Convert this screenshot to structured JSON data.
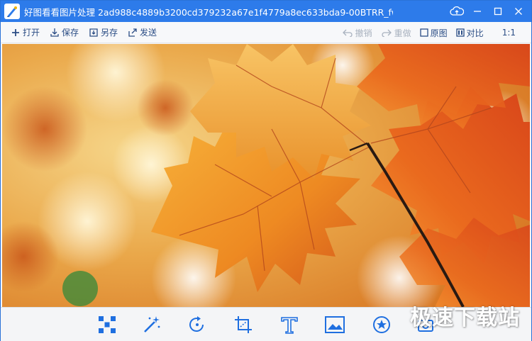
{
  "window": {
    "title": "好图看看图片处理 2ad988c4889b3200cd379232a67e1f4779a8ec633bda9-00BTRR_fw..."
  },
  "toolbar": {
    "open_label": "打开",
    "save_label": "保存",
    "save_as_label": "另存",
    "send_label": "发送",
    "undo_label": "撤销",
    "redo_label": "重做",
    "original_label": "原图",
    "compare_label": "对比",
    "ratio_label": "1:1"
  },
  "watermark": {
    "text": "极速下载站"
  },
  "colors": {
    "titlebar": "#2d7bea",
    "toolbar_text": "#2b4d85",
    "disabled_text": "#a9b2bf",
    "bottom_icon": "#1f6fe0"
  },
  "bottom_tools": [
    "mosaic-icon",
    "magic-wand-icon",
    "rotate-icon",
    "crop-icon",
    "text-icon",
    "frame-icon",
    "sticker-icon",
    "camera-icon"
  ]
}
